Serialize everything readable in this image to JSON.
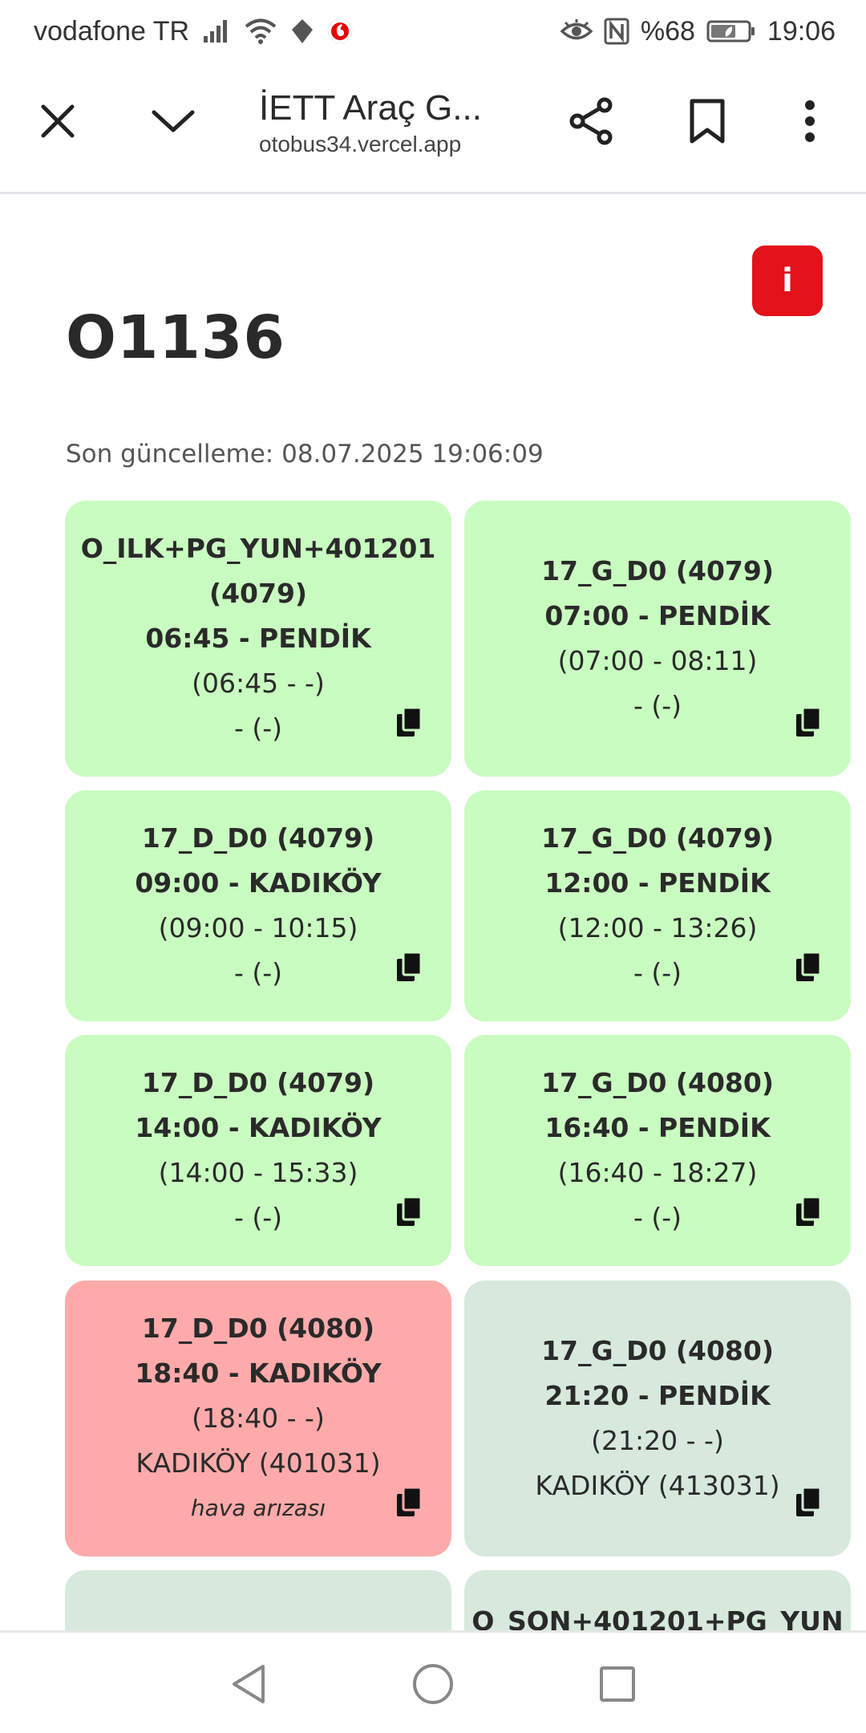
{
  "status_bar": {
    "carrier": "vodafone TR",
    "battery": "%68",
    "time": "19:06",
    "icons": [
      "signal-icon",
      "wifi-icon",
      "data-saver-icon",
      "vodafone-icon",
      "eye-icon",
      "nfc-icon",
      "battery-icon"
    ]
  },
  "browser": {
    "title": "İETT Araç G...",
    "url": "otobus34.vercel.app",
    "icons": [
      "close-icon",
      "chevron-down-icon",
      "share-icon",
      "bookmark-icon",
      "more-vert-icon"
    ]
  },
  "page": {
    "info_label": "i",
    "title": "O1136",
    "last_update": "Son güncelleme: 08.07.2025 19:06:09"
  },
  "colors": {
    "completed": "#c9fcc0",
    "fault": "#ffaaaa",
    "planned": "#d6e9dc",
    "info_button": "#e3121b"
  },
  "trips": [
    {
      "status": "green",
      "line1": "O_ILK+PG_YUN+401201",
      "line2": "(4079)",
      "line3": "06:45 - PENDİK",
      "line4": "(06:45 - -)",
      "line5": "- (-)",
      "note": ""
    },
    {
      "status": "green",
      "line1": "17_G_D0 (4079)",
      "line2": "07:00 - PENDİK",
      "line3": "(07:00 - 08:11)",
      "line4": "- (-)",
      "line5": "",
      "note": ""
    },
    {
      "status": "green",
      "line1": "17_D_D0 (4079)",
      "line2": "09:00 - KADIKÖY",
      "line3": "(09:00 - 10:15)",
      "line4": "- (-)",
      "line5": "",
      "note": ""
    },
    {
      "status": "green",
      "line1": "17_G_D0 (4079)",
      "line2": "12:00 - PENDİK",
      "line3": "(12:00 - 13:26)",
      "line4": "- (-)",
      "line5": "",
      "note": ""
    },
    {
      "status": "green",
      "line1": "17_D_D0 (4079)",
      "line2": "14:00 - KADIKÖY",
      "line3": "(14:00 - 15:33)",
      "line4": "- (-)",
      "line5": "",
      "note": ""
    },
    {
      "status": "green",
      "line1": "17_G_D0 (4080)",
      "line2": "16:40 - PENDİK",
      "line3": "(16:40 - 18:27)",
      "line4": "- (-)",
      "line5": "",
      "note": ""
    },
    {
      "status": "red",
      "line1": "17_D_D0 (4080)",
      "line2": "18:40 - KADIKÖY",
      "line3": "(18:40 - -)",
      "line4": "KADIKÖY (401031)",
      "line5": "",
      "note": "hava arızası"
    },
    {
      "status": "grey",
      "line1": "17_G_D0 (4080)",
      "line2": "21:20 - PENDİK",
      "line3": "(21:20 - -)",
      "line4": "KADIKÖY (413031)",
      "line5": "",
      "note": ""
    },
    {
      "status": "grey",
      "line1": "",
      "line2": "",
      "line3": "",
      "line4": "",
      "line5": "",
      "note": ""
    },
    {
      "status": "grey",
      "line1": "O_SON+401201+PG_YUN",
      "line2": "",
      "line3": "",
      "line4": "",
      "line5": "",
      "note": ""
    }
  ],
  "nav": {
    "icons": [
      "back-icon",
      "home-icon",
      "recents-icon"
    ]
  }
}
